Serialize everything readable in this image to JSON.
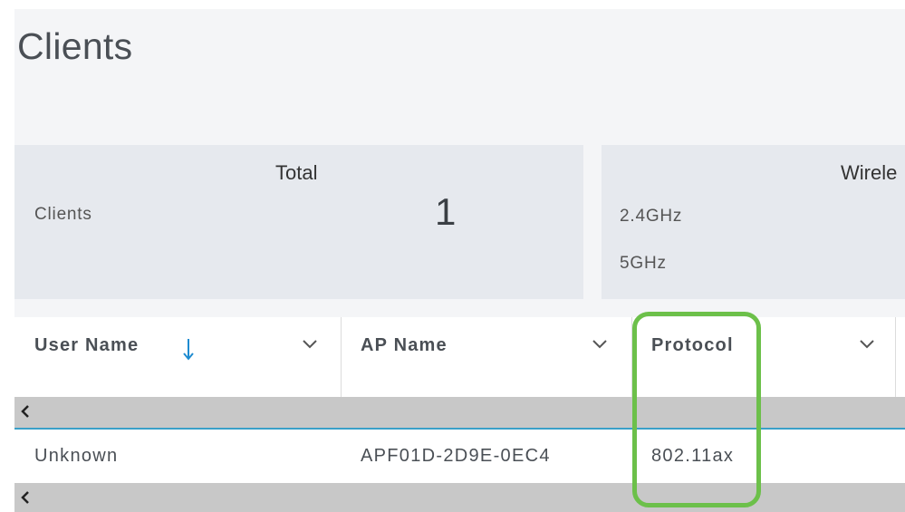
{
  "page": {
    "title": "Clients"
  },
  "summary": {
    "total": {
      "header": "Total",
      "row_label": "Clients",
      "value": "1"
    },
    "wireless": {
      "header": "Wirele",
      "bands": [
        "2.4GHz",
        "5GHz"
      ]
    }
  },
  "table": {
    "columns": [
      {
        "label": "User Name",
        "sorted": "descending"
      },
      {
        "label": "AP Name"
      },
      {
        "label": "Protocol"
      }
    ],
    "rows": [
      [
        "Unknown",
        "APF01D-2D9E-0EC4",
        "802.11ax"
      ]
    ]
  },
  "colors": {
    "highlight": "#6cc04a",
    "sort_arrow": "#1e8bd0",
    "card_bg": "#e6e9ee",
    "scrollbar": "#c8c8c8"
  },
  "icons": {
    "sort": "arrow-down-icon",
    "column_menu": "chevron-down-icon",
    "scroll_left": "chevron-left-icon"
  }
}
